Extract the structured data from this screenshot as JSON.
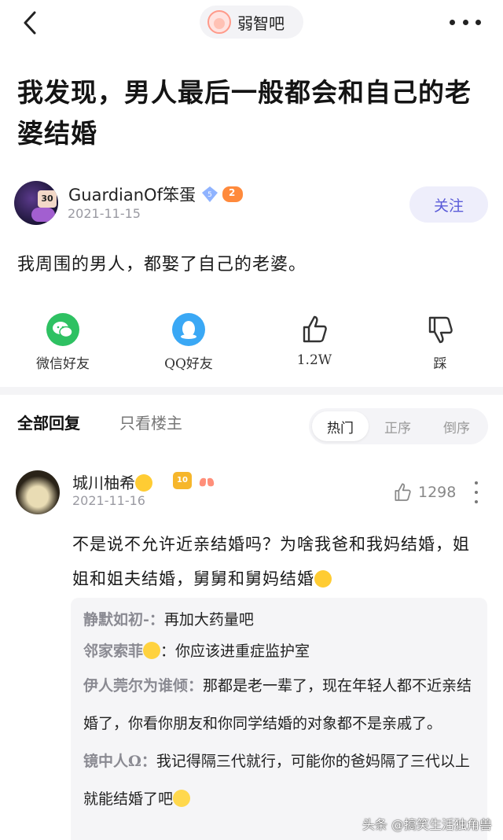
{
  "header": {
    "forum_name": "弱智吧"
  },
  "post": {
    "title": "我发现，男人最后一般都会和自己的老婆结婚",
    "author": {
      "name": "GuardianOf笨蛋",
      "date": "2021-11-15",
      "level_badge": "5",
      "game_badge": "2"
    },
    "follow_label": "关注",
    "body": "我周围的男人，都娶了自己的老婆。"
  },
  "share": {
    "wechat_label": "微信好友",
    "qq_label": "QQ好友",
    "like_label": "1.2W",
    "dislike_label": "踩"
  },
  "tabs": {
    "all_replies": "全部回复",
    "op_only": "只看楼主",
    "sort": [
      "热门",
      "正序",
      "倒序"
    ],
    "active_sort": "热门"
  },
  "comment": {
    "name": "城川柚希",
    "date": "2021-11-16",
    "level": "10",
    "likes": "1298",
    "text": "不是说不允许近亲结婚吗？为啥我爸和我妈结婚，姐姐和姐夫结婚，舅舅和舅妈结婚",
    "replies": [
      {
        "name": "静默如初-：",
        "text": "再加大药量吧"
      },
      {
        "name": "邻家索菲",
        "suffix": "：",
        "text": "你应该进重症监护室"
      },
      {
        "name": "伊人莞尔为谁倾：",
        "text": "那都是老一辈了，现在年轻人都不近亲结婚了，你看你朋友和你同学结婚的对象都不是亲戚了。"
      },
      {
        "name": "镜中人Ω：",
        "text": "我记得隔三代就行，可能你的爸妈隔了三代以上就能结婚了吧"
      }
    ]
  },
  "watermark": "头条 @搞笑生活独角兽"
}
